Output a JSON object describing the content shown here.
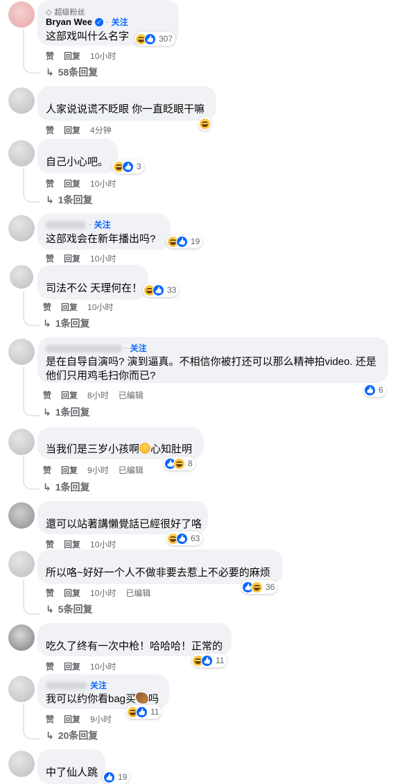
{
  "ui": {
    "like": "赞",
    "reply": "回复",
    "edited": "已编辑",
    "follow": "关注",
    "dot": "·",
    "top_fan_badge": "超级粉丝",
    "verified_icon": "check-icon",
    "reply_arrow": "↳"
  },
  "colors": {
    "link_blue": "#0866ff",
    "bubble": "#f0f2f5",
    "muted": "#65676b"
  },
  "comments": [
    {
      "author": "Bryan Wee",
      "text": "这部戏叫什么名字",
      "reactions": 307,
      "time": "10小时",
      "replies": "58条回复"
    },
    {
      "text": "人家说说谎不眨眼 你一直眨眼干嘛",
      "time": "4分钟"
    },
    {
      "text": "自己小心吧。",
      "reactions": 3,
      "time": "10小时",
      "replies": "1条回复"
    },
    {
      "text": "这部戏会在新年播出吗?",
      "reactions": 19,
      "time": "10小时"
    },
    {
      "text": "司法不公 天理何在！",
      "reactions": 33,
      "time": "10小时",
      "replies": "1条回复"
    },
    {
      "text_line1": "是在自导自演吗? 演到逼真。不相信你被打还可以那么精神拍video. 还是",
      "text_line2": "他们只用鸡毛扫你而已?",
      "reactions": 6,
      "time": "8小时",
      "replies": "1条回复"
    },
    {
      "text_before": "当我们是三岁小孩啊",
      "text_after": "心知肚明",
      "reactions": 8,
      "time": "9小时",
      "replies": "1条回复"
    },
    {
      "text": "還可以站著講懶覺話已經很好了咯",
      "reactions": 63,
      "time": "10小时"
    },
    {
      "text": "所以咯~好好一个人不做非要去惹上不必要的麻烦",
      "reactions": 36,
      "time": "10小时",
      "replies": "5条回复"
    },
    {
      "text": "吃久了终有一次中枪！哈哈哈！正常的",
      "reactions": 11,
      "time": "10小时"
    },
    {
      "text_before": "我可以约你看bag买",
      "text_after": "吗",
      "reactions": 11,
      "time": "9小时",
      "replies": "20条回复"
    },
    {
      "text": "中了仙人跳",
      "reactions": 19
    }
  ]
}
